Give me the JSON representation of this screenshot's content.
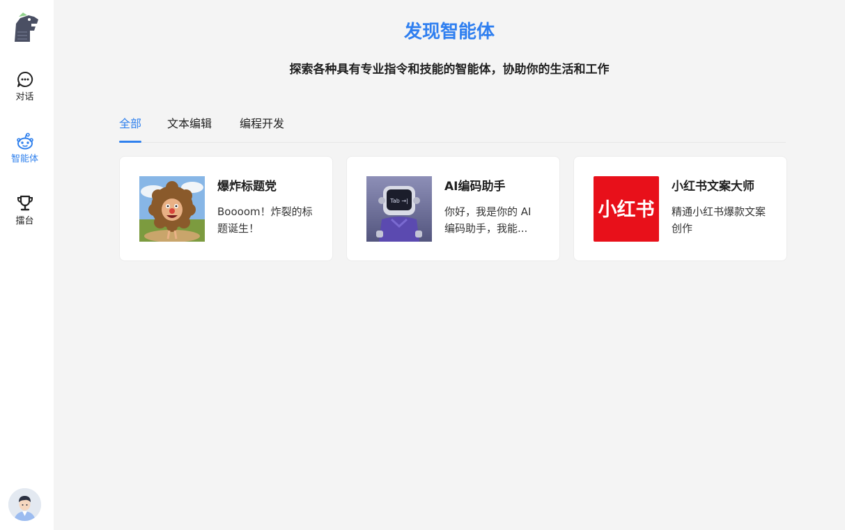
{
  "sidebar": {
    "logo_icon": "dinosaur-logo-icon",
    "items": [
      {
        "label": "对话",
        "icon": "chat-bubble-icon",
        "active": false
      },
      {
        "label": "智能体",
        "icon": "robot-face-icon",
        "active": true
      },
      {
        "label": "擂台",
        "icon": "trophy-icon",
        "active": false
      }
    ],
    "avatar_icon": "user-avatar-icon"
  },
  "main": {
    "title": "发现智能体",
    "subtitle": "探索各种具有专业指令和技能的智能体，协助你的生活和工作",
    "tabs": [
      {
        "label": "全部",
        "active": true
      },
      {
        "label": "文本编辑",
        "active": false
      },
      {
        "label": "编程开发",
        "active": false
      }
    ],
    "cards": [
      {
        "title": "爆炸标题党",
        "description": "Boooom！炸裂的标题诞生！",
        "thumb": "explosion-character-image"
      },
      {
        "title": "AI编码助手",
        "description": "你好，我是你的 AI 编码助手，我能...",
        "thumb": "tab-robot-image",
        "thumb_screen_text": "Tab →|"
      },
      {
        "title": "小红书文案大师",
        "description": "精通小红书爆款文案创作",
        "thumb": "xiaohongshu-logo-image",
        "thumb_logo_text": "小红书"
      }
    ]
  },
  "colors": {
    "accent": "#2f80ed",
    "background": "#f4f4f4",
    "xiaohongshu_red": "#e8101a"
  }
}
